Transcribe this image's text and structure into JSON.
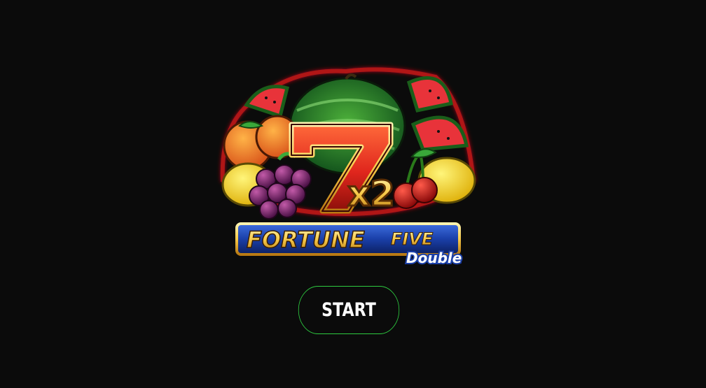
{
  "game": {
    "logo": {
      "name": "Fortune Five Double",
      "seven_text": "7",
      "multiplier_text": "x2",
      "title_word1": "FORTUNE",
      "title_word2": "FIVE",
      "title_word3": "Double"
    },
    "start_button": {
      "label": "START"
    }
  },
  "colors": {
    "background": "#0b0b0b",
    "button_border": "#2ecc40",
    "button_text": "#ffffff",
    "seven_red": "#e0261d",
    "seven_gold": "#f7c948",
    "title_blue": "#1a3fa8",
    "title_gold": "#f5c542"
  },
  "icons": [
    "watermelon-icon",
    "orange-icon",
    "lemon-icon",
    "grapes-icon",
    "cherries-icon",
    "seven-icon"
  ]
}
